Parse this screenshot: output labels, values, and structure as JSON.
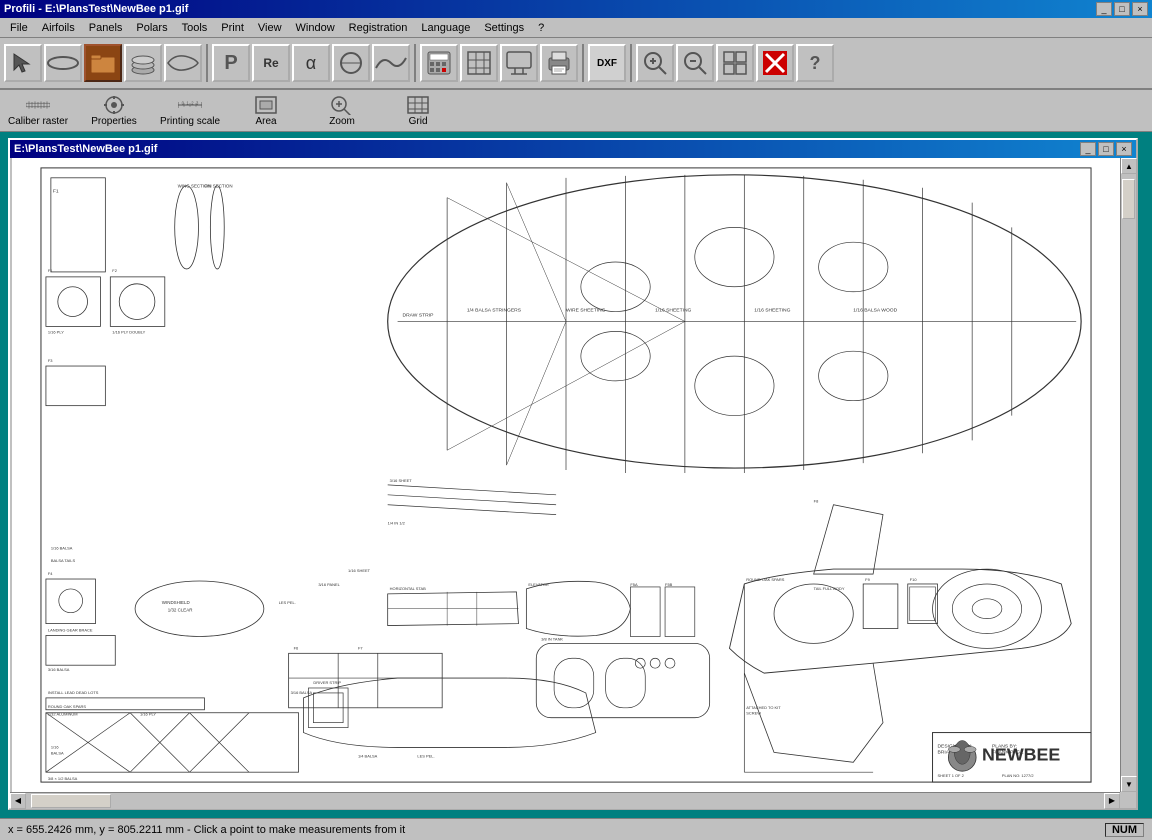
{
  "app": {
    "title": "Profili - E:\\PlansTest\\NewBee p1.gif",
    "title_icon": "P"
  },
  "menu": {
    "items": [
      "File",
      "Airfoils",
      "Panels",
      "Polars",
      "Tools",
      "Print",
      "View",
      "Window",
      "Registration",
      "Language",
      "Settings",
      "?"
    ]
  },
  "toolbar": {
    "buttons": [
      {
        "name": "arrow-tool",
        "icon": "↖",
        "label": ""
      },
      {
        "name": "airfoil-oval",
        "icon": "⬭",
        "label": ""
      },
      {
        "name": "folder-open",
        "icon": "📁",
        "label": ""
      },
      {
        "name": "layers",
        "icon": "▤",
        "label": ""
      },
      {
        "name": "wing-shape",
        "icon": "✈",
        "label": ""
      },
      {
        "name": "print-preview",
        "icon": "P",
        "label": ""
      },
      {
        "name": "text-re",
        "icon": "Re",
        "label": ""
      },
      {
        "name": "text-alpha",
        "icon": "α",
        "label": ""
      },
      {
        "name": "circle-tool",
        "icon": "◎",
        "label": ""
      },
      {
        "name": "wave-tool",
        "icon": "〜",
        "label": ""
      },
      {
        "name": "calculator",
        "icon": "🖩",
        "label": ""
      },
      {
        "name": "grid-tool",
        "icon": "⊞",
        "label": ""
      },
      {
        "name": "display",
        "icon": "🖥",
        "label": ""
      },
      {
        "name": "printer",
        "icon": "🖨",
        "label": ""
      },
      {
        "name": "dxf-export",
        "icon": "DXF",
        "label": ""
      },
      {
        "name": "zoom-in",
        "icon": "🔍",
        "label": ""
      },
      {
        "name": "zoom-out",
        "icon": "🔎",
        "label": ""
      },
      {
        "name": "grid-view",
        "icon": "⊞",
        "label": ""
      },
      {
        "name": "cross-mark",
        "icon": "✕",
        "label": ""
      },
      {
        "name": "help",
        "icon": "?",
        "label": ""
      }
    ]
  },
  "toolbar2": {
    "items": [
      {
        "name": "caliber-raster",
        "label": "Caliber raster",
        "icon": "📏"
      },
      {
        "name": "properties",
        "label": "Properties",
        "icon": "⚙"
      },
      {
        "name": "printing-scale",
        "label": "Printing scale",
        "icon": "📐"
      },
      {
        "name": "area",
        "label": "Area",
        "icon": "□"
      },
      {
        "name": "zoom",
        "label": "Zoom",
        "icon": "🔍"
      },
      {
        "name": "grid",
        "label": "Grid",
        "icon": "⊞"
      }
    ]
  },
  "sub_window": {
    "title": "E:\\PlansTest\\NewBee p1.gif",
    "title_icon": "img"
  },
  "status_bar": {
    "coordinates": "x = 655.2426 mm, y = 805.2211 mm - Click a point to make measurements from it",
    "num_label": "NUM"
  }
}
